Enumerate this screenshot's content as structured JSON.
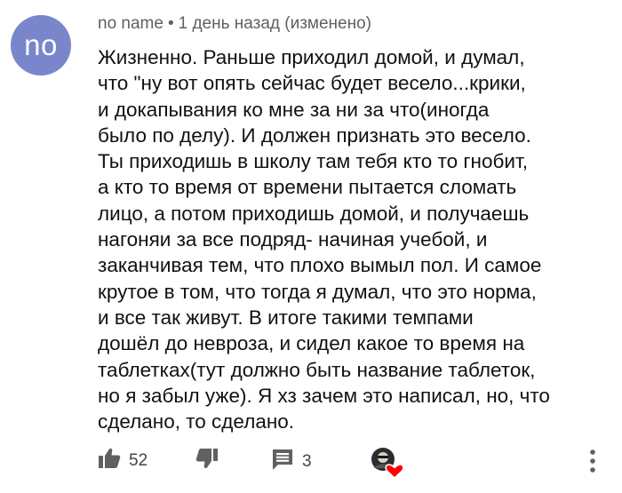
{
  "author": {
    "avatar_text": "no",
    "avatar_color": "#7986cb",
    "name": "no name",
    "separator": "•",
    "meta": "1 день назад (изменено)"
  },
  "comment": {
    "text": "Жизненно. Раньше приходил домой, и думал,\nчто \"ну вот опять сейчас будет весело...крики,\nи докапывания ко мне за ни за что(иногда\nбыло по делу). И должен признать это весело.\nТы приходишь в школу там тебя кто то гнобит,\nа кто то время от времени пытается сломать\nлицо, а потом приходишь домой, и получаешь\nнагоняи за все подряд- начиная учебой, и\nзаканчивая тем, что плохо вымыл пол. И самое\nкрутое в том, что тогда я думал, что это норма,\nи все так живут. В итоге такими темпами\nдошёл до невроза, и сидел какое то время на\nтаблетках(тут должно быть название таблеток,\nно я забыл уже). Я хз зачем это написал, но, что\nсделано, то сделано."
  },
  "actions": {
    "like_icon": "thumbs-up-icon",
    "like_count": "52",
    "dislike_icon": "thumbs-down-icon",
    "reply_icon": "comment-icon",
    "reply_count": "3",
    "creator_heart": "creator-heart-icon",
    "heart_color": "#ff0000",
    "more_icon": "more-vertical-icon"
  }
}
